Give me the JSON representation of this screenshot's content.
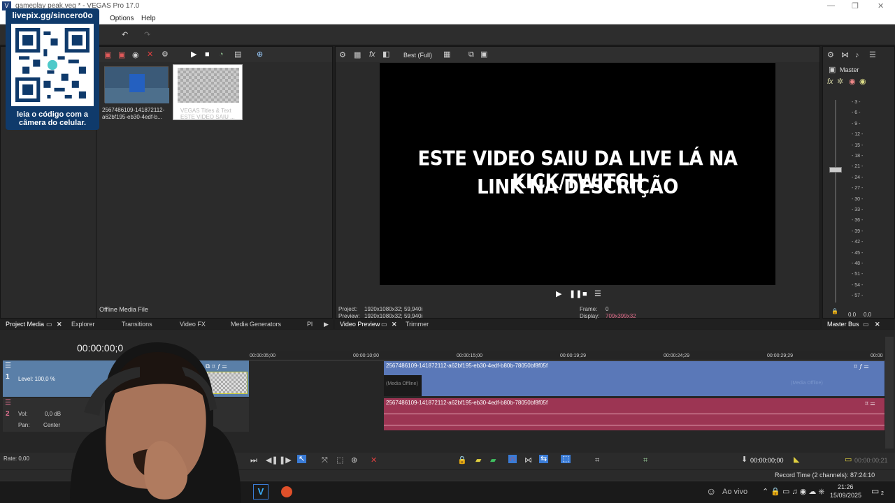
{
  "window": {
    "title": "gameplay peak.veg * - VEGAS Pro 17.0",
    "minimize": "—",
    "maximize": "❐",
    "close": "✕"
  },
  "menu": [
    "Options",
    "Help"
  ],
  "overlay": {
    "url": "livepix.gg/sincero0o",
    "caption_line1": "leia o código com a",
    "caption_line2": "câmera do celular."
  },
  "project_media": {
    "items": [
      {
        "label_line1": "2567486109-141872112-",
        "label_line2": "a62bf195-eb30-4edf-b..."
      },
      {
        "label_line1": "VEGAS Titles & Text",
        "label_line2": "ESTE VIDEO SAIU ..."
      }
    ],
    "status": "Offline Media File"
  },
  "tabs_left": [
    "Project Media",
    "Explorer",
    "Transitions",
    "Video FX",
    "Media Generators",
    "Pl"
  ],
  "preview": {
    "quality": "Best (Full)",
    "caption_line1": "ESTE VIDEO SAIU DA LIVE LÁ NA KICK/TWITCH",
    "caption_line2": "LINK NA DESCRIÇÃO",
    "project_label": "Project:",
    "project_value": "1920x1080x32; 59,940i",
    "preview_label": "Preview:",
    "preview_value": "1920x1080x32; 59,940i",
    "frame_label": "Frame:",
    "frame_value": "0",
    "display_label": "Display:",
    "display_value": "709x399x32"
  },
  "tabs_mid": [
    "Video Preview",
    "Trimmer"
  ],
  "master": {
    "label": "Master",
    "tab": "Master Bus",
    "scale": [
      "3",
      "6",
      "9",
      "12",
      "15",
      "18",
      "21",
      "24",
      "27",
      "30",
      "33",
      "36",
      "39",
      "42",
      "45",
      "48",
      "51",
      "54",
      "57"
    ],
    "left_value": "0.0",
    "right_value": "0.0"
  },
  "timeline": {
    "timecode": "00:00:00;0",
    "ruler": [
      "00:00:05;00",
      "00:00:10;00",
      "00:00:15;00",
      "00:00:19;29",
      "00:00:24;29",
      "00:00:29;29",
      "00:00"
    ],
    "video_track": {
      "number": "1",
      "level_label": "Level: 100,0 %"
    },
    "audio_track": {
      "number": "2",
      "vol_label": "Vol:",
      "vol_value": "0,0 dB",
      "pan_label": "Pan:",
      "pan_value": "Center"
    },
    "video_clip": "2567486109-141872112-a62bf195-eb30-4edf-b80b-78050bf8f05f",
    "audio_clip": "2567486109-141872112-a62bf195-eb30-4edf-b80b-78050bf8f05f",
    "media_offline": "(Media Offline)",
    "media_offline_right": "(Media Offline)",
    "rate": "Rate: 0,00",
    "cursor_time": "00:00:00;00",
    "end_time": "00:00:00;21",
    "record_time": "Record Time (2 channels): 87:24:10"
  },
  "taskbar": {
    "live": "Ao vivo",
    "time": "21:26",
    "date": "15/09/2025",
    "notif": "2"
  }
}
